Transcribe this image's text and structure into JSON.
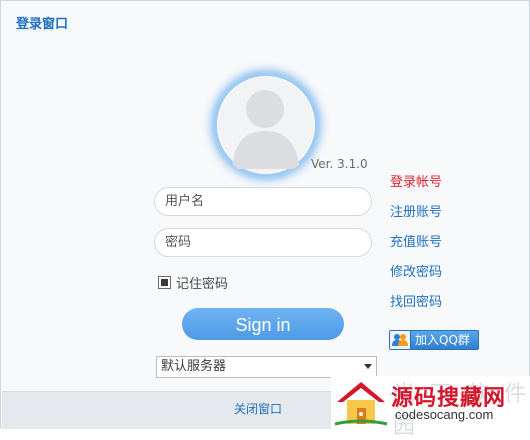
{
  "window": {
    "title": "登录窗口"
  },
  "profile": {
    "version": "Ver. 3.1.0"
  },
  "form": {
    "username_placeholder": "用户名",
    "username_value": "",
    "password_placeholder": "密码",
    "password_value": "",
    "remember_label": "记住密码",
    "remember_checked": true,
    "sign_in_label": "Sign in",
    "server_selected": "默认服务器"
  },
  "side_links": [
    {
      "label": "登录帐号",
      "active": true
    },
    {
      "label": "注册账号",
      "active": false
    },
    {
      "label": "充值账号",
      "active": false
    },
    {
      "label": "修改密码",
      "active": false
    },
    {
      "label": "找回密码",
      "active": false
    }
  ],
  "qq_button": {
    "label": "加入QQ群"
  },
  "footer": {
    "close_label": "关闭窗口"
  },
  "watermark": {
    "ghost_text": "光 下 软 件 园",
    "title": "源码搜藏网",
    "subtitle": "codesocang.com"
  },
  "colors": {
    "accent": "#1f6fbf",
    "active_link": "#d8262e",
    "sign_in_button": "#5aa5ec",
    "footer_bg": "#e5e9ee"
  },
  "icons": {
    "avatar": "user-silhouette-icon",
    "qq": "qq-group-icon",
    "dropdown": "chevron-down-icon",
    "watermark": "house-logo-icon"
  }
}
